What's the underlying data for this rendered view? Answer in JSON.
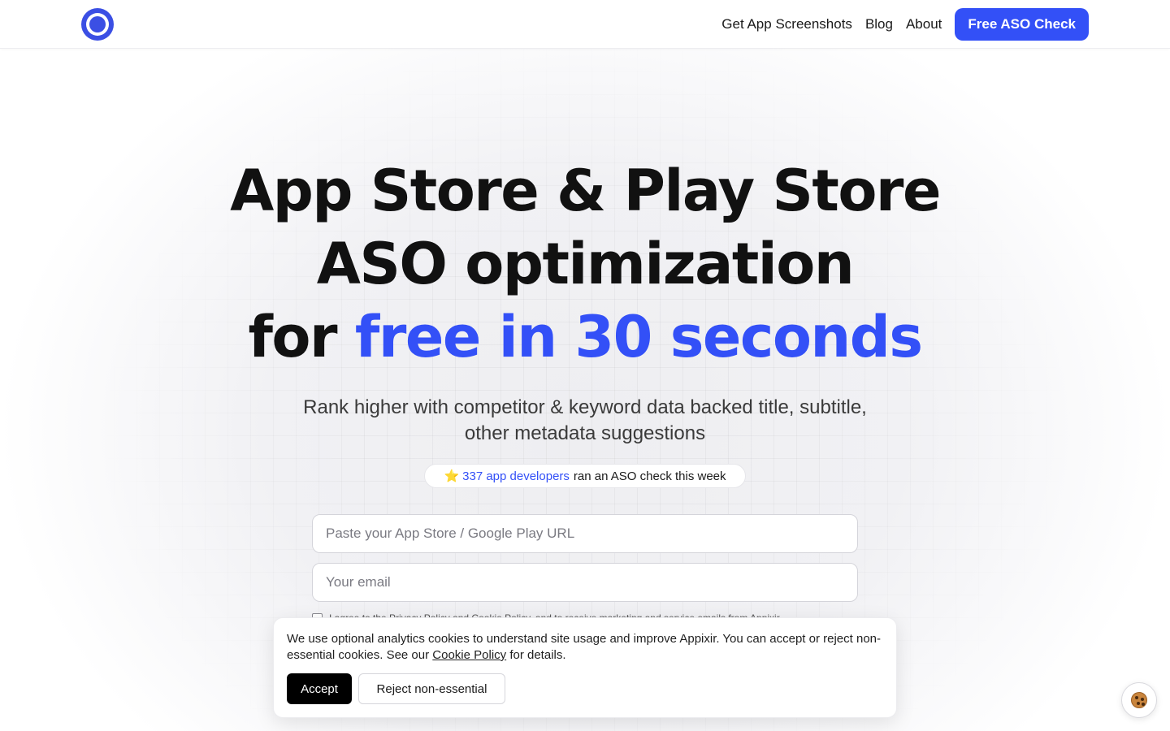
{
  "nav": {
    "logo_icon": "appixir-ring-logo",
    "links": [
      "Get App Screenshots",
      "Blog",
      "About"
    ],
    "cta": "Free ASO Check"
  },
  "hero": {
    "headline_line1": "App Store & Play Store",
    "headline_line2": "ASO optimization",
    "headline_line3_prefix": "for",
    "headline_line3_accent": "free in 30 seconds",
    "subheadline": "Rank higher with competitor & keyword data backed title, subtitle, other metadata suggestions",
    "social_proof": {
      "icon": "star-icon",
      "star_glyph": "⭐",
      "count_text": "337 app developers",
      "rest_text": "ran an ASO check this week"
    },
    "form": {
      "url_placeholder": "Paste your App Store / Google Play URL",
      "email_placeholder": "Your email",
      "consent_text": "I agree to the Privacy Policy and Cookie Policy, and to receive marketing and service emails from Appixir."
    }
  },
  "cookie_banner": {
    "text_before_link": "We use optional analytics cookies to understand site usage and improve Appixir. You can accept or reject non-essential cookies. See our",
    "link_text": "Cookie Policy",
    "text_after_link": "for details.",
    "accept_label": "Accept",
    "reject_label": "Reject non-essential",
    "settings_icon": "cookie-icon"
  },
  "colors": {
    "accent": "#3350f7",
    "logo": "#3b4fe4",
    "accept_button": "#000000"
  }
}
